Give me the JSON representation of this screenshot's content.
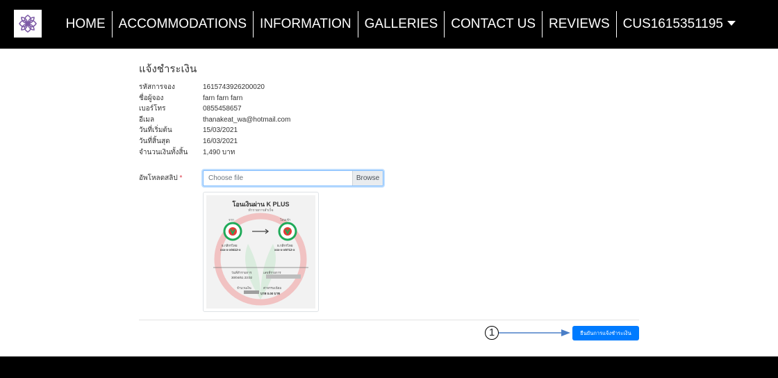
{
  "nav": {
    "items": [
      "HOME",
      "ACCOMMODATIONS",
      "INFORMATION",
      "GALLERIES",
      "CONTACT US",
      "REVIEWS"
    ],
    "user": "CUS1615351195"
  },
  "page": {
    "title": "แจ้งชำระเงิน"
  },
  "booking": {
    "rows": [
      {
        "label": "รหัสการจอง",
        "value": "1615743926200020"
      },
      {
        "label": "ชื่อผู้จอง",
        "value": "farn farn farn"
      },
      {
        "label": "เบอร์โทร",
        "value": "0855458657"
      },
      {
        "label": "อีเมล",
        "value": "thanakeat_wa@hotmail.com"
      },
      {
        "label": "วันที่เริ่มต้น",
        "value": "15/03/2021"
      },
      {
        "label": "วันที่สิ้นสุด",
        "value": "16/03/2021"
      },
      {
        "label": "จำนวนเงินทั้งสิ้น",
        "value": "1,490 บาท"
      }
    ]
  },
  "upload": {
    "label": "อัพโหลดสลิป",
    "required_mark": "*",
    "placeholder": "Choose file",
    "browse": "Browse"
  },
  "slip": {
    "title": "โอนเงินผ่าน K PLUS",
    "status": "ทำรายการสำเร็จ",
    "from_label": "จาก",
    "to_label": "โอนเข้า",
    "from_bank": "ธ.กสิกรไทย",
    "from_acct": "xxx-x-x0412-x",
    "to_bank": "ธ.กสิกรไทย",
    "to_acct": "xxx-x-x5712-x",
    "date_label": "วันที่ทำรายการ",
    "date_value": "30/04/61 23:02",
    "ref_label": "เลขที่รายการ",
    "amount_label": "จำนวนเงิน",
    "amount_value": "บาท",
    "fee_label": "ค่าธรรมเนียม",
    "fee_value": "0.00 บาท"
  },
  "submit": {
    "label": "ยืนยันการแจ้งชำระเงิน"
  },
  "callout": {
    "number": "1"
  },
  "colors": {
    "primary": "#007bff",
    "nav_bg": "#000000",
    "kbank_green": "#1faa59",
    "logo": "#7d5ba6"
  }
}
